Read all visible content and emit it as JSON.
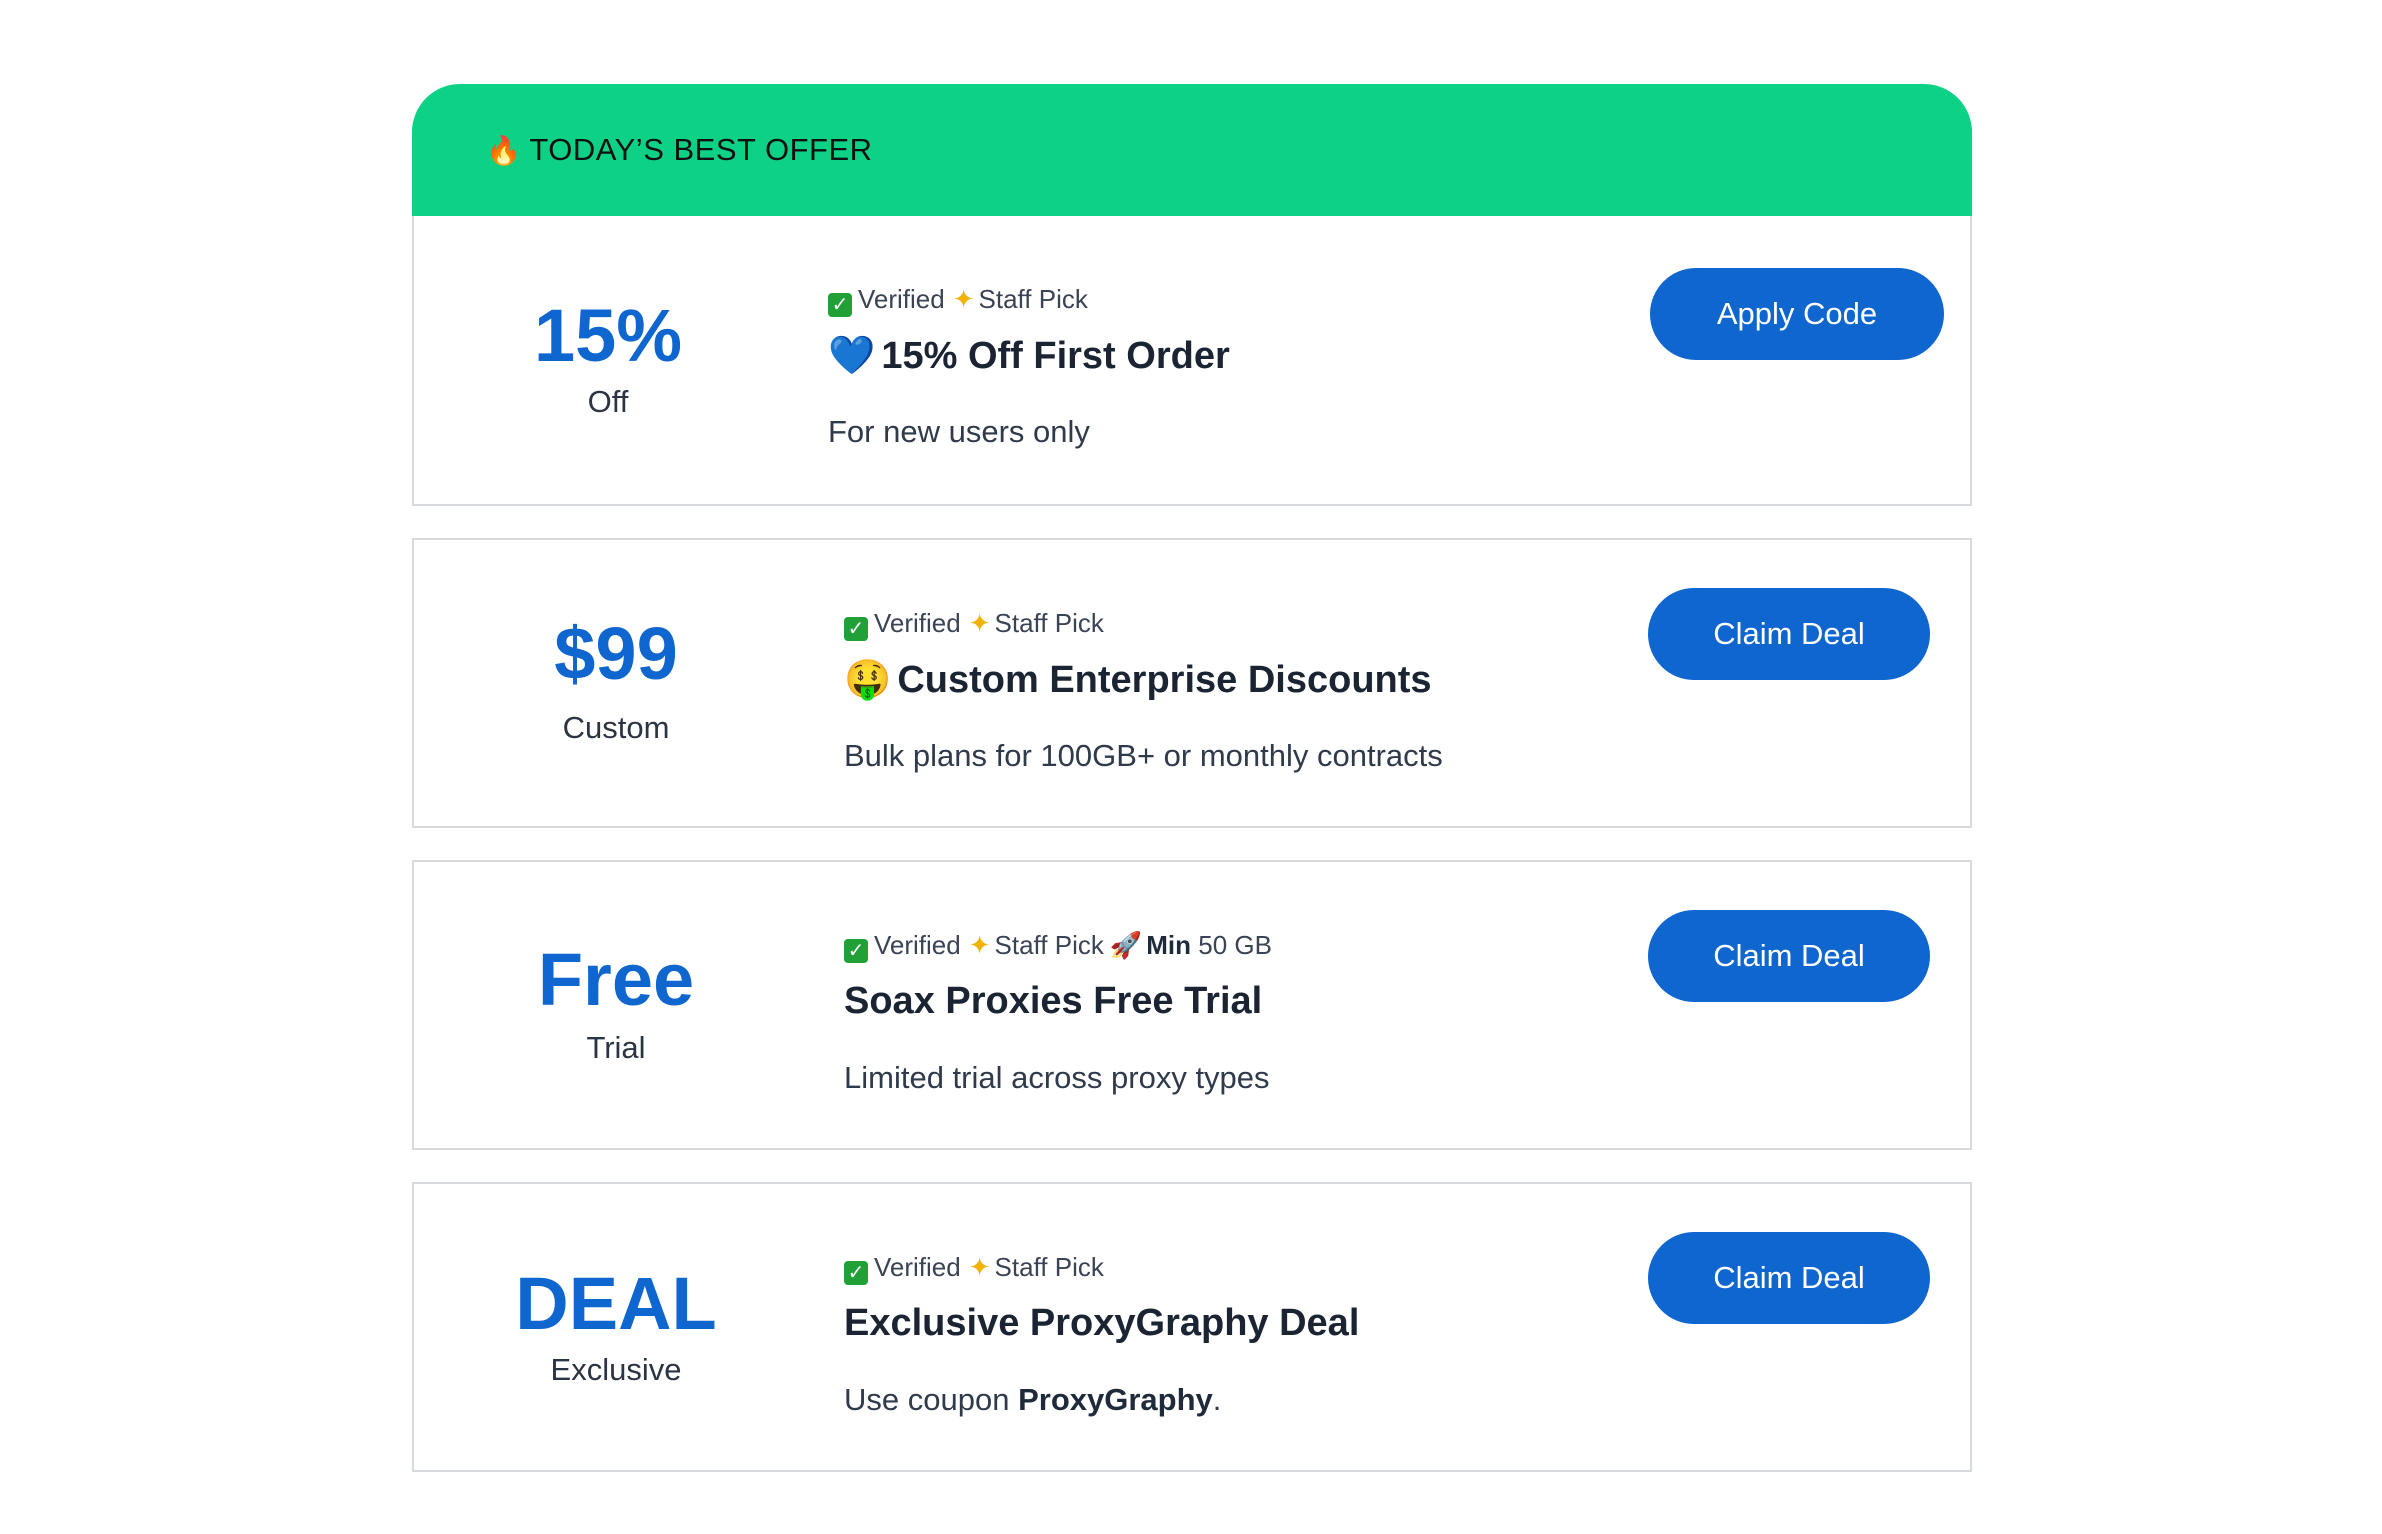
{
  "banner": {
    "icon": "fire-icon",
    "label": "TODAY’S BEST OFFER"
  },
  "colors": {
    "banner_bg": "#0dd286",
    "accent_blue": "#0f66cf",
    "card_border": "#d6d9dd"
  },
  "offers": [
    {
      "amount": "15%",
      "amount_sub": "Off",
      "verified": "Verified",
      "staff_pick": "Staff Pick",
      "title_icon": "blue-heart-icon",
      "title": "15% Off First Order",
      "description": "For new users only",
      "button": "Apply Code"
    },
    {
      "amount": "$99",
      "amount_sub": "Custom",
      "verified": "Verified",
      "staff_pick": "Staff Pick",
      "title_icon": "money-mouth-face-icon",
      "title": "Custom Enterprise Discounts",
      "description": "Bulk plans for 100GB+ or monthly contracts",
      "button": "Claim Deal"
    },
    {
      "amount": "Free",
      "amount_sub": "Trial",
      "verified": "Verified",
      "staff_pick": "Staff Pick",
      "min_label": "Min",
      "min_value": "50 GB",
      "title": "Soax Proxies Free Trial",
      "description": "Limited trial across proxy types",
      "button": "Claim Deal"
    },
    {
      "amount": "DEAL",
      "amount_sub": "Exclusive",
      "verified": "Verified",
      "staff_pick": "Staff Pick",
      "title": "Exclusive ProxyGraphy Deal",
      "description_prefix": "Use coupon",
      "coupon_code": "ProxyGraphy",
      "description_suffix": ".",
      "button": "Claim Deal"
    }
  ]
}
